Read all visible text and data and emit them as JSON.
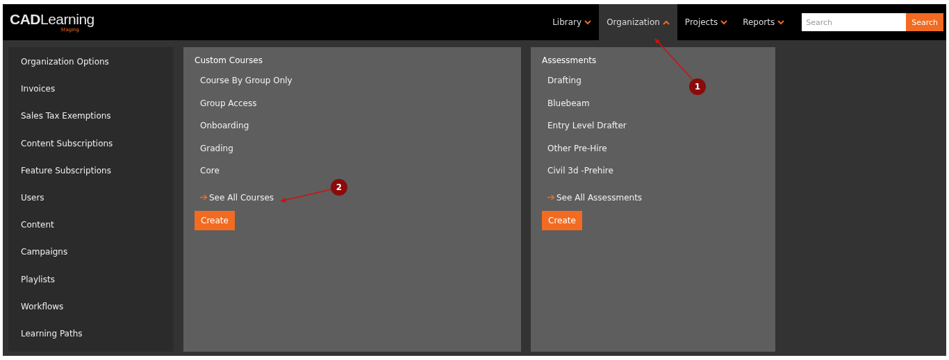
{
  "header": {
    "logo": "**CAD**Learning",
    "logo_subtitle": "Staging",
    "nav": [
      {
        "label": "Library",
        "selected": false,
        "expanded": false
      },
      {
        "label": "Organization",
        "selected": true,
        "expanded": true
      },
      {
        "label": "Projects",
        "selected": false,
        "expanded": false
      },
      {
        "label": "Reports",
        "selected": false,
        "expanded": false
      }
    ],
    "search": {
      "placeholder": "Search",
      "button": "Search"
    }
  },
  "menu": {
    "items": [
      "Organization Options",
      "Invoices",
      "Sales Tax Exemptions",
      "Content Subscriptions",
      "Feature Subscriptions",
      "Users",
      "Content",
      "Campaigns",
      "Playlists",
      "Workflows",
      "Learning Paths"
    ],
    "panels": [
      {
        "title": "Custom Courses",
        "items": [
          "Course By Group Only",
          "Group Access",
          "Onboarding",
          "Grading",
          "Core"
        ],
        "see_all": "See All Courses",
        "button": "Create"
      },
      {
        "title": "Assessments",
        "items": [
          "Drafting",
          "Bluebeam",
          "Entry Level Drafter",
          "Other Pre-Hire",
          "Civil 3d -Prehire"
        ],
        "see_all": "See All Assessments",
        "button": "Create"
      }
    ]
  },
  "annotations": [
    {
      "label": "1"
    },
    {
      "label": "2"
    }
  ]
}
